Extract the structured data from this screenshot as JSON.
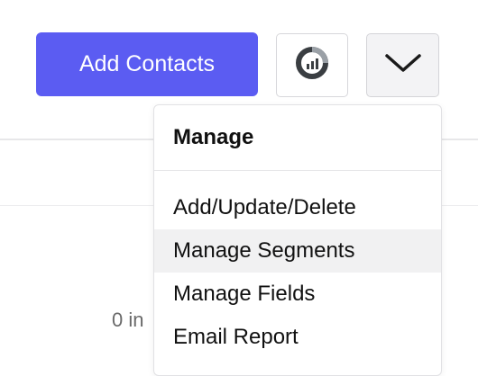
{
  "toolbar": {
    "add_contacts_label": "Add Contacts",
    "chart_button_icon": "report-chart-icon",
    "dropdown_icon": "chevron-down-icon"
  },
  "background": {
    "partial_text": "0 in"
  },
  "menu": {
    "header": "Manage",
    "items": [
      {
        "label": "Add/Update/Delete",
        "active": false
      },
      {
        "label": "Manage Segments",
        "active": true
      },
      {
        "label": "Manage Fields",
        "active": false
      },
      {
        "label": "Email Report",
        "active": false
      }
    ]
  },
  "colors": {
    "primary": "#5b5cf2",
    "icon_dark": "#3a3e42",
    "hover_bg": "#f1f1f2"
  }
}
